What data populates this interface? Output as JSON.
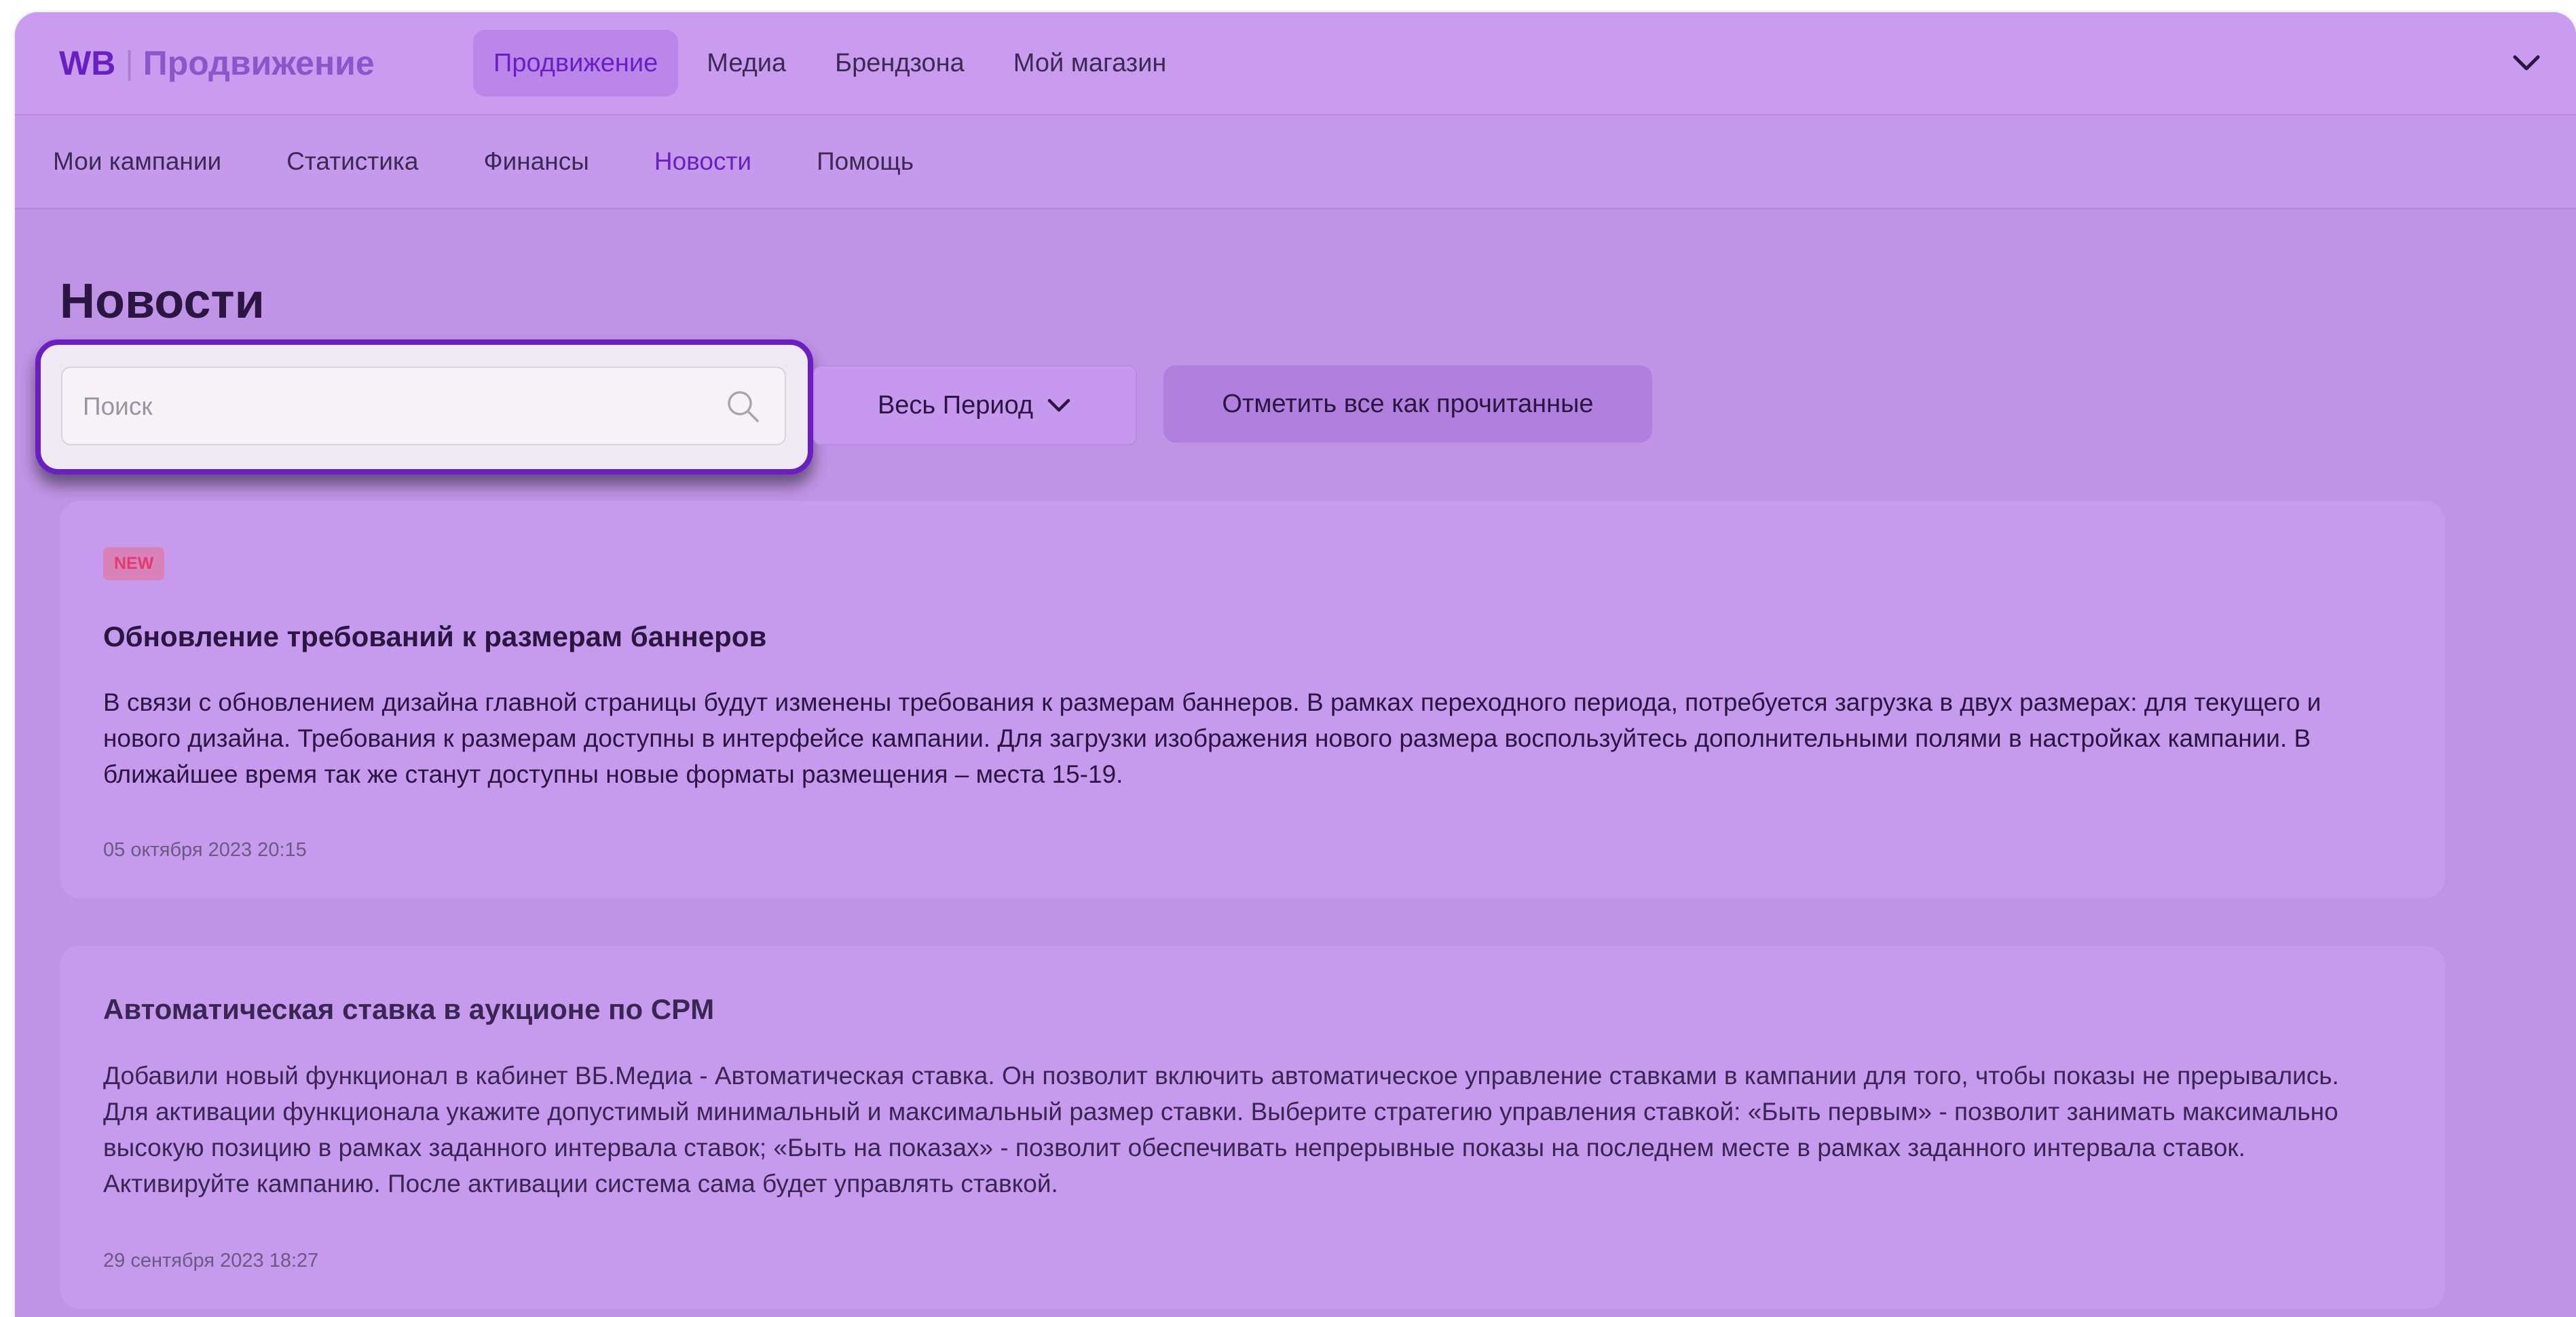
{
  "header": {
    "logo_brand": "WB",
    "logo_separator": "|",
    "logo_name": "Продвижение",
    "nav": [
      {
        "label": "Продвижение",
        "active": true
      },
      {
        "label": "Медиа",
        "active": false
      },
      {
        "label": "Брендзона",
        "active": false
      },
      {
        "label": "Мой магазин",
        "active": false
      }
    ],
    "expand_icon": "chevron-down-icon"
  },
  "subnav": {
    "items": [
      {
        "label": "Мои кампании",
        "active": false
      },
      {
        "label": "Статистика",
        "active": false
      },
      {
        "label": "Финансы",
        "active": false
      },
      {
        "label": "Новости",
        "active": true
      },
      {
        "label": "Помощь",
        "active": false
      }
    ]
  },
  "page": {
    "title": "Новости"
  },
  "filters": {
    "search_placeholder": "Поиск",
    "search_value": "",
    "search_icon": "search-icon",
    "period_label": "Весь Период",
    "mark_all_label": "Отметить все как прочитанные"
  },
  "news": [
    {
      "badge": "NEW",
      "title": "Обновление требований к размерам баннеров",
      "body": "В связи с обновлением дизайна главной страницы будут изменены требования к размерам баннеров. В рамках переходного периода, потребуется загрузка в двух размерах: для текущего и нового дизайна. Требования к размерам доступны в интерфейсе кампании. Для загрузки изображения нового размера воспользуйтесь дополнительными полями в настройках кампании. В ближайшее время так же станут доступны новые форматы размещения – места 15-19.",
      "date": "05 октября 2023 20:15"
    },
    {
      "badge": "",
      "title": "Автоматическая ставка в аукционе по CPM",
      "body": "Добавили новый функционал в кабинет ВБ.Медиа - Автоматическая ставка. Он позволит включить автоматическое управление ставками в кампании для того, чтобы показы не прерывались. Для активации функционала укажите допустимый минимальный и максимальный размер ставки. Выберите стратегию управления ставкой: «Быть первым» - позволит занимать максимально высокую позицию в рамках заданного интервала ставок; «Быть на показах» - позволит обеспечивать непрерывные показы на последнем месте в рамках заданного интервала ставок. Активируйте кампанию. После активации система сама будет управлять ставкой.",
      "date": "29 сентября 2023 18:27"
    }
  ],
  "colors": {
    "accent": "#6a1fc4",
    "overlay_tint": "#c194e8",
    "badge_text": "#e33b6f"
  }
}
